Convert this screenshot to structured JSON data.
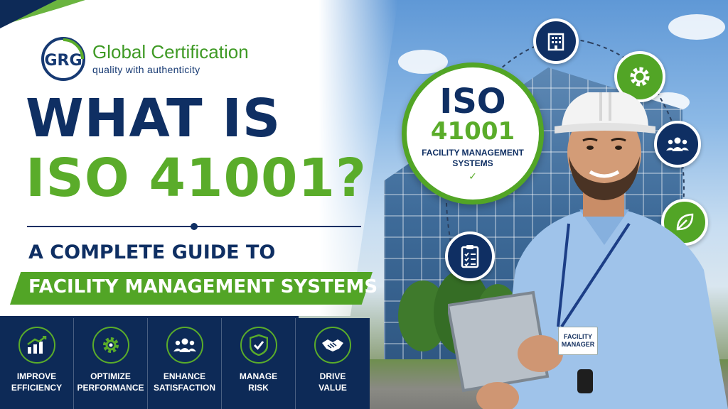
{
  "brand": {
    "name": "Global Certification",
    "tagline": "quality with authenticity",
    "monogram": "GRG"
  },
  "headline": {
    "line1": "WHAT IS",
    "line2": "ISO 41001?"
  },
  "subtitle": "A COMPLETE GUIDE TO",
  "ribbon": "FACILITY MANAGEMENT SYSTEMS",
  "benefits": [
    {
      "icon": "growth-chart-icon",
      "line1": "IMPROVE",
      "line2": "EFFICIENCY"
    },
    {
      "icon": "gear-icon",
      "line1": "OPTIMIZE",
      "line2": "PERFORMANCE"
    },
    {
      "icon": "people-icon",
      "line1": "ENHANCE",
      "line2": "SATISFACTION"
    },
    {
      "icon": "shield-check-icon",
      "line1": "MANAGE",
      "line2": "RISK"
    },
    {
      "icon": "handshake-icon",
      "line1": "DRIVE",
      "line2": "VALUE"
    }
  ],
  "badge": {
    "iso": "ISO",
    "number": "41001",
    "label_line1": "FACILITY MANAGEMENT",
    "label_line2": "SYSTEMS",
    "check": "✓"
  },
  "orbit_icons": [
    "building-icon",
    "gear-icon",
    "people-icon",
    "leaf-icon",
    "checklist-icon"
  ],
  "id_card": {
    "line1": "FACILITY",
    "line2": "MANAGER"
  },
  "colors": {
    "navy": "#0f2f63",
    "green": "#52a526",
    "white": "#ffffff"
  }
}
